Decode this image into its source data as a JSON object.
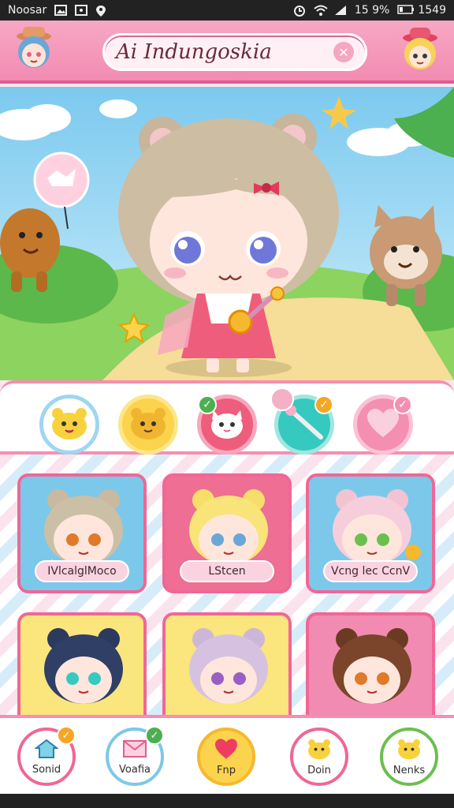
{
  "status_bar": {
    "carrier": "Noosar",
    "battery": "15 9%",
    "time": "1549"
  },
  "header": {
    "title": "Ai Indungoskia"
  },
  "actions": [
    {
      "name": "bear-face-action"
    },
    {
      "name": "bear-face-yellow-action"
    },
    {
      "name": "cat-face-action",
      "checked": true
    },
    {
      "name": "wand-action",
      "checked": true
    },
    {
      "name": "heart-action",
      "checked": true
    }
  ],
  "cards": [
    {
      "label": "IVlcalglMoco"
    },
    {
      "label": "LStcen"
    },
    {
      "label": "Vcng lec CcnV"
    },
    {
      "label": ""
    },
    {
      "label": ""
    },
    {
      "label": ""
    }
  ],
  "bottom_nav": [
    {
      "label": "Sonid"
    },
    {
      "label": "Voafia"
    },
    {
      "label": "Fnp"
    },
    {
      "label": "Doin"
    },
    {
      "label": "Nenks"
    }
  ],
  "colors": {
    "accent": "#f06795",
    "header": "#f28bb1",
    "teal": "#36c9c0",
    "yellow": "#fcd34d"
  }
}
